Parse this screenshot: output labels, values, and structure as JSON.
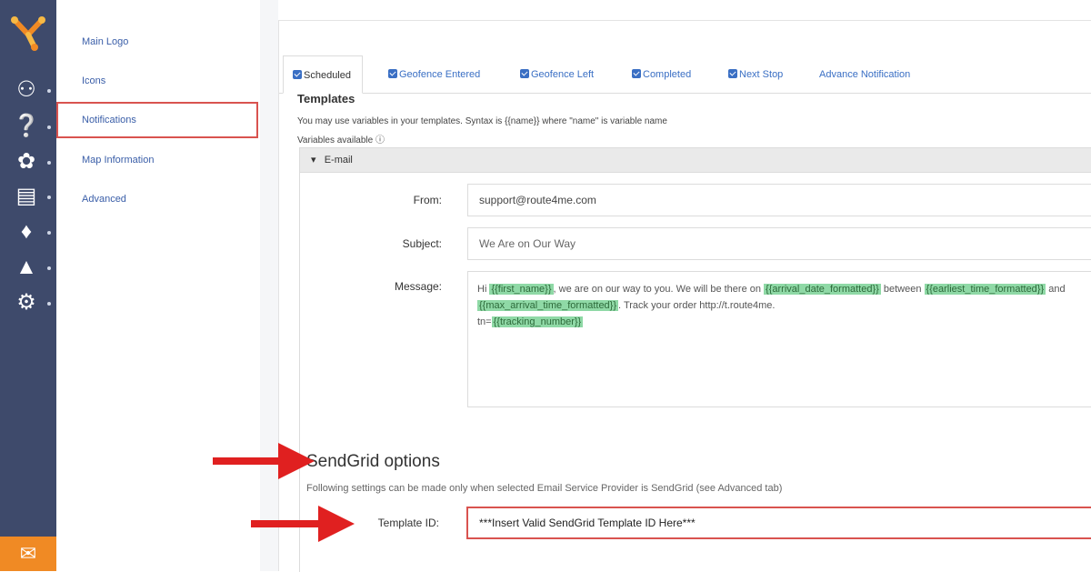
{
  "subnav": {
    "items": [
      {
        "label": "Main Logo"
      },
      {
        "label": "Icons"
      },
      {
        "label": "Notifications"
      },
      {
        "label": "Map Information"
      },
      {
        "label": "Advanced"
      }
    ]
  },
  "tabs": [
    {
      "label": "Scheduled",
      "checked": true,
      "active": true
    },
    {
      "label": "Geofence Entered",
      "checked": true
    },
    {
      "label": "Geofence Left",
      "checked": true
    },
    {
      "label": "Completed",
      "checked": true
    },
    {
      "label": "Next Stop",
      "checked": true
    },
    {
      "label": "Advance Notification",
      "checked": false
    }
  ],
  "templates": {
    "title": "Templates",
    "hint1": "You may use variables in your templates. Syntax is {{name}} where \"name\" is variable name",
    "hint2": "Variables available ⓘ"
  },
  "email": {
    "section_label": "E-mail",
    "from_label": "From:",
    "from_value": "support@route4me.com",
    "subject_label": "Subject:",
    "subject_value": "We Are on Our Way",
    "message_label": "Message:",
    "message_parts": {
      "p1": "Hi ",
      "v1": "{{first_name}}",
      "p2": ", we are on our way to you. We will be there on ",
      "v2": "{{arrival_date_formatted}}",
      "p3": " between ",
      "v3": "{{earliest_time_formatted}}",
      "p4": " and ",
      "v4": "{{max_arrival_time_formatted}}",
      "p5": ". Track your order http://t.route4me.",
      "p6": "tn=",
      "v5": "{{tracking_number}}"
    }
  },
  "sendgrid": {
    "title": "SendGrid options",
    "hint": "Following settings can be made only when selected Email Service Provider is SendGrid (see Advanced tab)",
    "template_id_label": "Template ID:",
    "template_id_value": "***Insert Valid SendGrid Template ID Here***"
  },
  "colors": {
    "rail": "#3e4a6b",
    "accent": "#3a6fc4",
    "highlight": "#d9534f",
    "arrow": "#e02020",
    "variable": "#8fd9a6",
    "chat": "#f08a24"
  }
}
